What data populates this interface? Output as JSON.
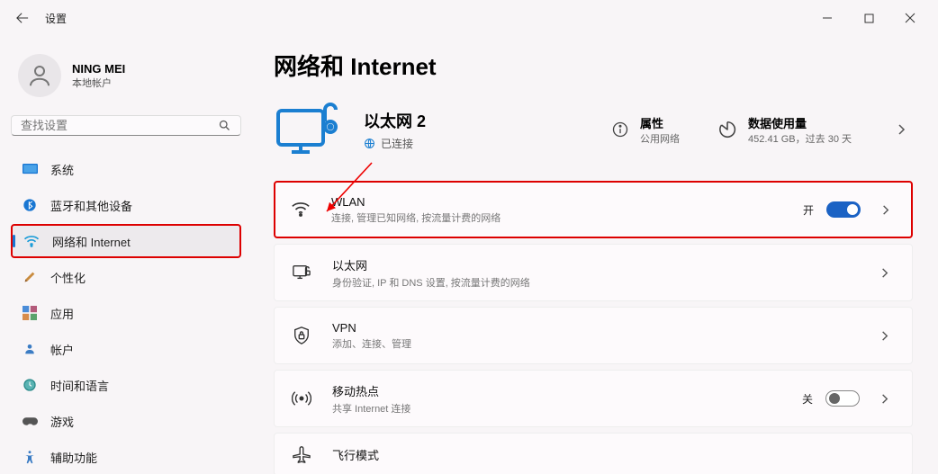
{
  "titlebar": {
    "title": "设置"
  },
  "profile": {
    "name": "NING MEI",
    "type": "本地帐户"
  },
  "search": {
    "placeholder": "查找设置"
  },
  "nav": {
    "items": [
      {
        "label": "系统"
      },
      {
        "label": "蓝牙和其他设备"
      },
      {
        "label": "网络和 Internet"
      },
      {
        "label": "个性化"
      },
      {
        "label": "应用"
      },
      {
        "label": "帐户"
      },
      {
        "label": "时间和语言"
      },
      {
        "label": "游戏"
      },
      {
        "label": "辅助功能"
      }
    ]
  },
  "main": {
    "page_title": "网络和 Internet",
    "status": {
      "conn_name": "以太网 2",
      "conn_state": "已连接",
      "properties_h": "属性",
      "properties_s": "公用网络",
      "data_h": "数据使用量",
      "data_s": "452.41 GB，过去 30 天"
    },
    "cards": {
      "wlan": {
        "title": "WLAN",
        "sub": "连接, 管理已知网络, 按流量计费的网络",
        "state": "开"
      },
      "ethernet": {
        "title": "以太网",
        "sub": "身份验证, IP 和 DNS 设置, 按流量计费的网络"
      },
      "vpn": {
        "title": "VPN",
        "sub": "添加、连接、管理"
      },
      "hotspot": {
        "title": "移动热点",
        "sub": "共享 Internet 连接",
        "state": "关"
      },
      "airplane": {
        "title": "飞行模式"
      }
    }
  }
}
